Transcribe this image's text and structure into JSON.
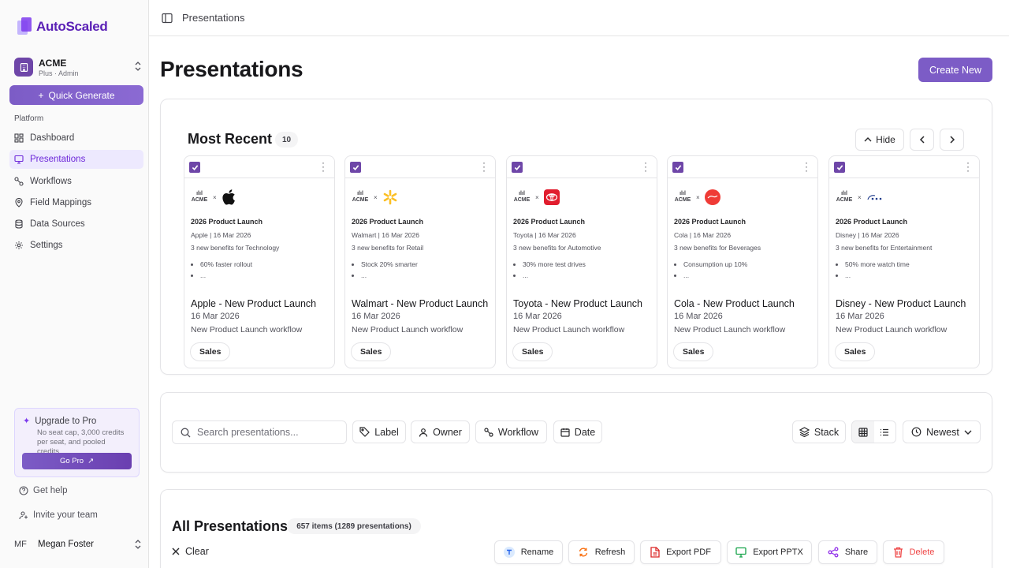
{
  "app": {
    "brand": "AutoScaled",
    "org_name": "ACME",
    "org_role": "Plus · Admin"
  },
  "sidebar": {
    "quick_generate": "Quick Generate",
    "section": "Platform",
    "items": [
      {
        "label": "Dashboard",
        "icon": "dashboard-icon"
      },
      {
        "label": "Presentations",
        "icon": "presentation-icon"
      },
      {
        "label": "Workflows",
        "icon": "workflow-icon"
      },
      {
        "label": "Field Mappings",
        "icon": "map-pin-icon"
      },
      {
        "label": "Data Sources",
        "icon": "database-icon"
      },
      {
        "label": "Settings",
        "icon": "gear-icon"
      }
    ],
    "upgrade": {
      "title": "Upgrade to Pro",
      "desc": "No seat cap, 3,000 credits per seat, and pooled credits.",
      "button": "Go Pro"
    },
    "get_help": "Get help",
    "invite": "Invite your team",
    "user_initials": "MF",
    "user_name": "Megan Foster"
  },
  "topbar": {
    "breadcrumb": "Presentations"
  },
  "page": {
    "title": "Presentations",
    "create_button": "Create New"
  },
  "recent": {
    "title": "Most Recent",
    "count": "10",
    "hide": "Hide",
    "cards": [
      {
        "brand": "Apple",
        "thumb_title": "2026 Product Launch",
        "thumb_sub": "Apple | 16 Mar 2026",
        "thumb_sub2": "3 new benefits for Technology",
        "bullet1": "60% faster rollout",
        "bullet2": "...",
        "name": "Apple - New Product Launch",
        "date": "16 Mar 2026",
        "workflow": "New Product Launch workflow",
        "tag": "Sales",
        "acme": "ACME",
        "x": "×"
      },
      {
        "brand": "Walmart",
        "thumb_title": "2026 Product Launch",
        "thumb_sub": "Walmart | 16 Mar 2026",
        "thumb_sub2": "3 new benefits for Retail",
        "bullet1": "Stock 20% smarter",
        "bullet2": "...",
        "name": "Walmart - New Product Launch",
        "date": "16 Mar 2026",
        "workflow": "New Product Launch workflow",
        "tag": "Sales",
        "acme": "ACME",
        "x": "×"
      },
      {
        "brand": "Toyota",
        "thumb_title": "2026 Product Launch",
        "thumb_sub": "Toyota | 16 Mar 2026",
        "thumb_sub2": "3 new benefits for Automotive",
        "bullet1": "30% more test drives",
        "bullet2": "...",
        "name": "Toyota - New Product Launch",
        "date": "16 Mar 2026",
        "workflow": "New Product Launch workflow",
        "tag": "Sales",
        "acme": "ACME",
        "x": "×"
      },
      {
        "brand": "Cola",
        "thumb_title": "2026 Product Launch",
        "thumb_sub": "Cola | 16 Mar 2026",
        "thumb_sub2": "3 new benefits for Beverages",
        "bullet1": "Consumption up 10%",
        "bullet2": "...",
        "name": "Cola - New Product Launch",
        "date": "16 Mar 2026",
        "workflow": "New Product Launch workflow",
        "tag": "Sales",
        "acme": "ACME",
        "x": "×"
      },
      {
        "brand": "Disney",
        "thumb_title": "2026 Product Launch",
        "thumb_sub": "Disney | 16 Mar 2026",
        "thumb_sub2": "3 new benefits for Entertainment",
        "bullet1": "50% more watch time",
        "bullet2": "...",
        "name": "Disney - New Product Launch",
        "date": "16 Mar 2026",
        "workflow": "New Product Launch workflow",
        "tag": "Sales",
        "acme": "ACME",
        "x": "×"
      }
    ]
  },
  "filters": {
    "search_placeholder": "Search presentations...",
    "label": "Label",
    "owner": "Owner",
    "workflow": "Workflow",
    "date": "Date",
    "stack": "Stack",
    "sort": "Newest"
  },
  "all": {
    "title": "All Presentations",
    "count": "657 items (1289 presentations)",
    "clear": "Clear",
    "actions": {
      "rename": "Rename",
      "refresh": "Refresh",
      "export_pdf": "Export PDF",
      "export_pptx": "Export PPTX",
      "share": "Share",
      "delete": "Delete"
    }
  },
  "colors": {
    "accent": "#7c5cc6",
    "checkbox": "#6e46a8",
    "danger": "#ef4444"
  }
}
